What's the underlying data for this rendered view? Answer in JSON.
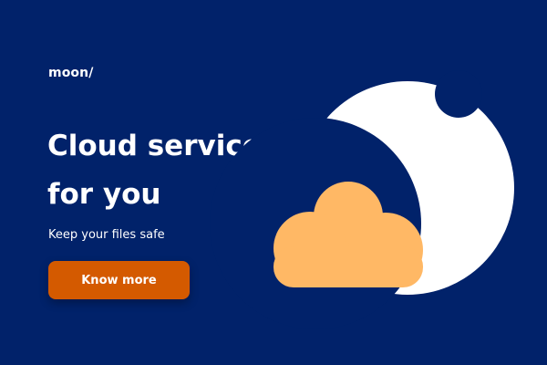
{
  "brand": {
    "logo_text": "moon/"
  },
  "hero": {
    "title_line1": "Cloud service",
    "title_line2": "for you",
    "subtitle": "Keep your files safe",
    "cta_label": "Know more"
  },
  "illustration": {
    "icons": [
      "moon-icon",
      "cloud-icon"
    ]
  },
  "colors": {
    "background": "#01226A",
    "text": "#FFFFFF",
    "cta": "#D45A00",
    "moon": "#FFFFFF",
    "cloud": "#FFB865"
  }
}
